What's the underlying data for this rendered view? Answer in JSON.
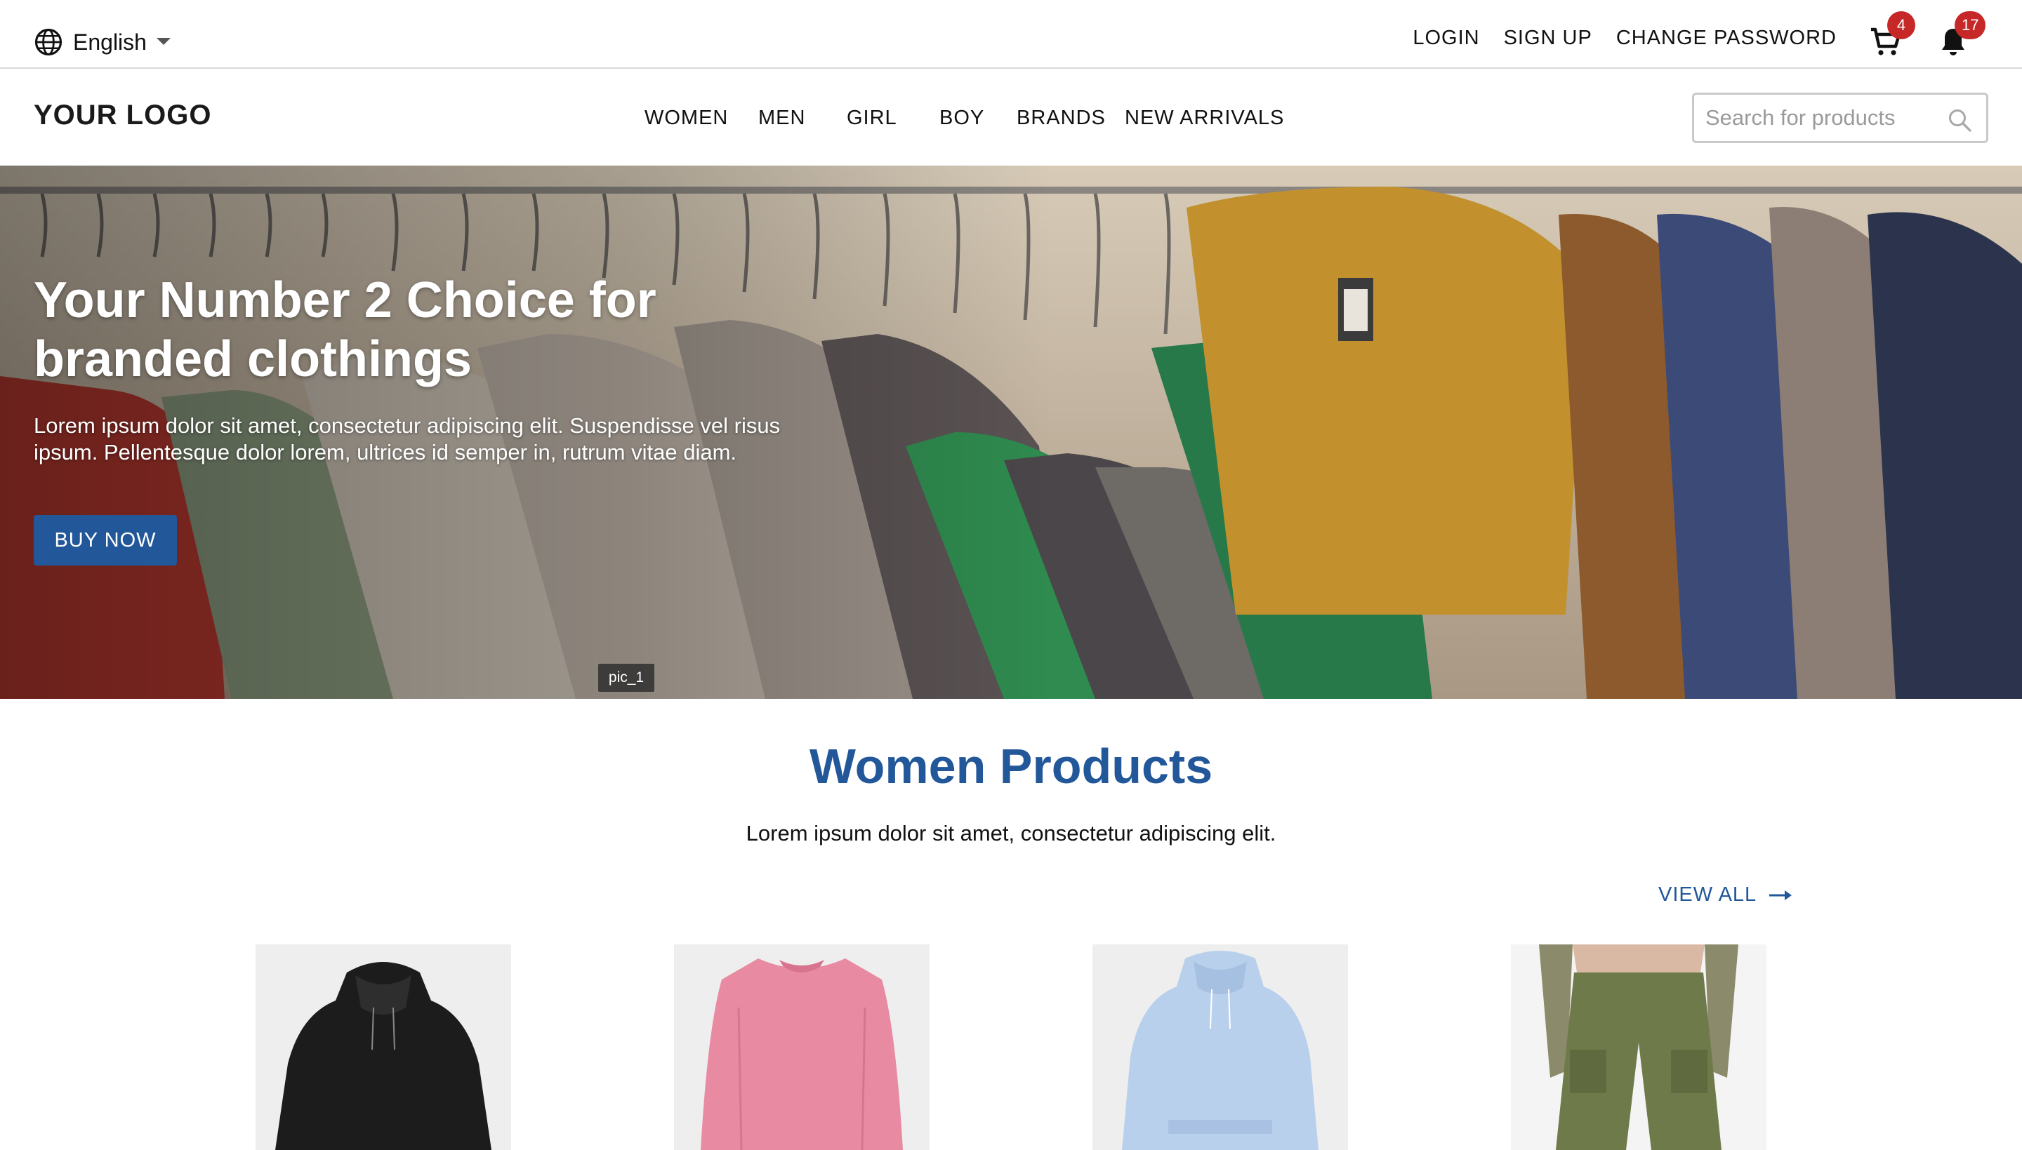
{
  "topbar": {
    "language": "English",
    "links": [
      "LOGIN",
      "SIGN UP",
      "CHANGE PASSWORD"
    ],
    "cart_count": "4",
    "notification_count": "17"
  },
  "header": {
    "logo": "YOUR LOGO",
    "nav": [
      "WOMEN",
      "MEN",
      "GIRL",
      "BOY",
      "BRANDS",
      "NEW ARRIVALS"
    ],
    "search_placeholder": "Search for products"
  },
  "hero": {
    "title": "Your Number 2 Choice for branded clothings",
    "text": "Lorem ipsum dolor sit amet, consectetur adipiscing elit. Suspendisse vel risus ipsum. Pellentesque dolor lorem, ultrices id semper in, rutrum vitae diam.",
    "button": "BUY NOW",
    "image_tag": "pic_1"
  },
  "section": {
    "title": "Women Products",
    "subtitle": "Lorem ipsum dolor sit amet, consectetur adipiscing elit.",
    "view_all": "VIEW ALL"
  },
  "products": [
    {
      "icon": "black-hoodie-image",
      "color": "#1c1c1c"
    },
    {
      "icon": "pink-sweatshirt-image",
      "color": "#e98aa3"
    },
    {
      "icon": "light-blue-hoodie-image",
      "color": "#b9d0ec"
    },
    {
      "icon": "green-cargo-pants-image",
      "color": "#6f7a4a"
    }
  ],
  "colors": {
    "brand": "#22579a",
    "badge": "#c62828"
  }
}
